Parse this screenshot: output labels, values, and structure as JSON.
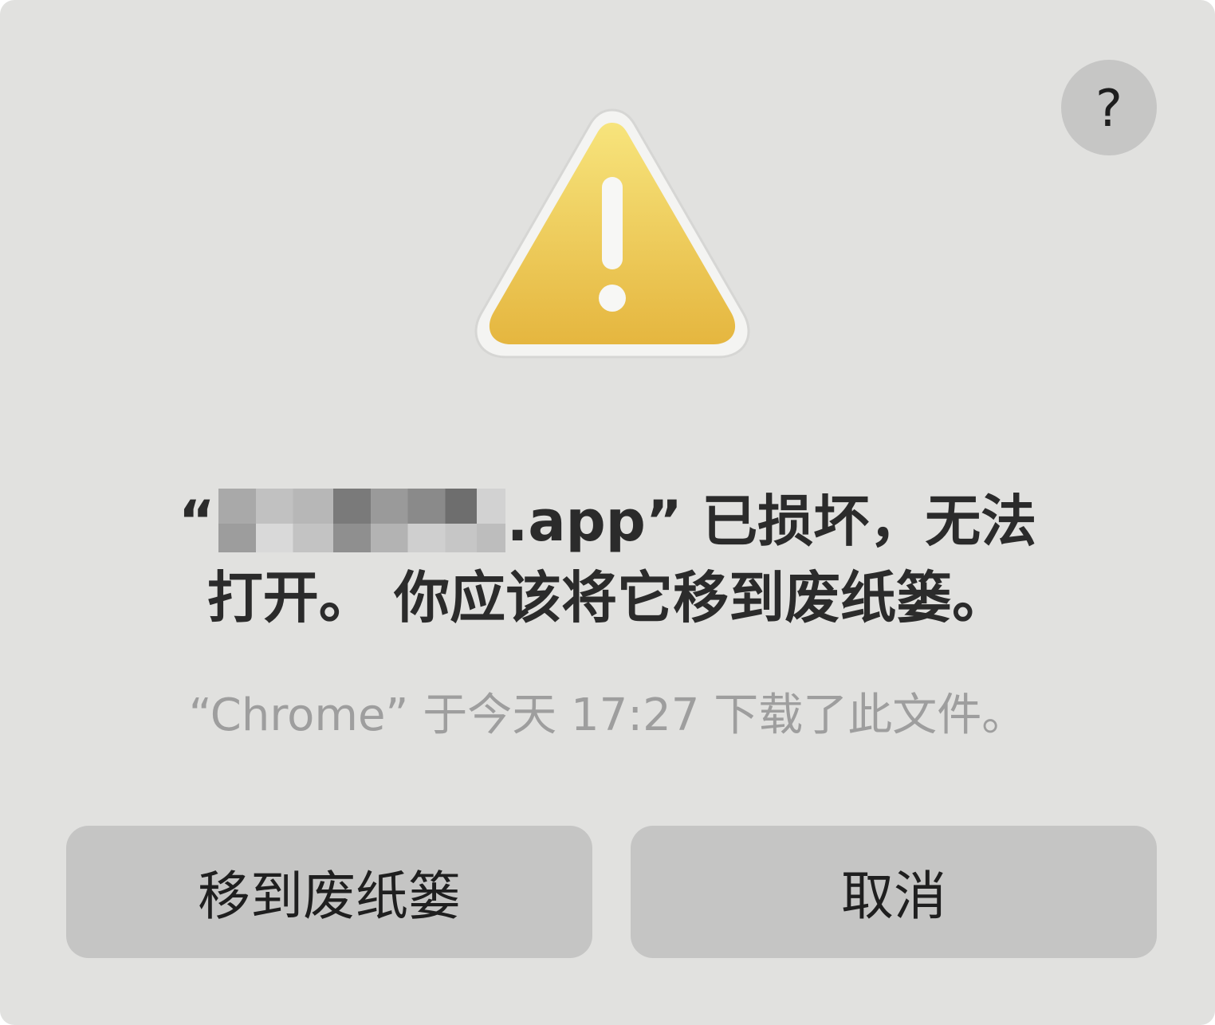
{
  "dialog": {
    "help_label": "?",
    "icon": "warning-triangle-icon",
    "title_line1_prefix": "“",
    "title_line1_suffix": ".app” 已损坏，无法",
    "title_line2": "打开。 你应该将它移到废纸篓。",
    "subtitle": "“Chrome” 于今天 17:27 下载了此文件。",
    "buttons": {
      "move_to_trash": "移到废纸篓",
      "cancel": "取消"
    }
  },
  "colors": {
    "dialog_bg": "#e1e1df",
    "button_bg": "#c5c5c4",
    "warning_yellow_top": "#f6e27a",
    "warning_yellow_bottom": "#e6b83f"
  }
}
